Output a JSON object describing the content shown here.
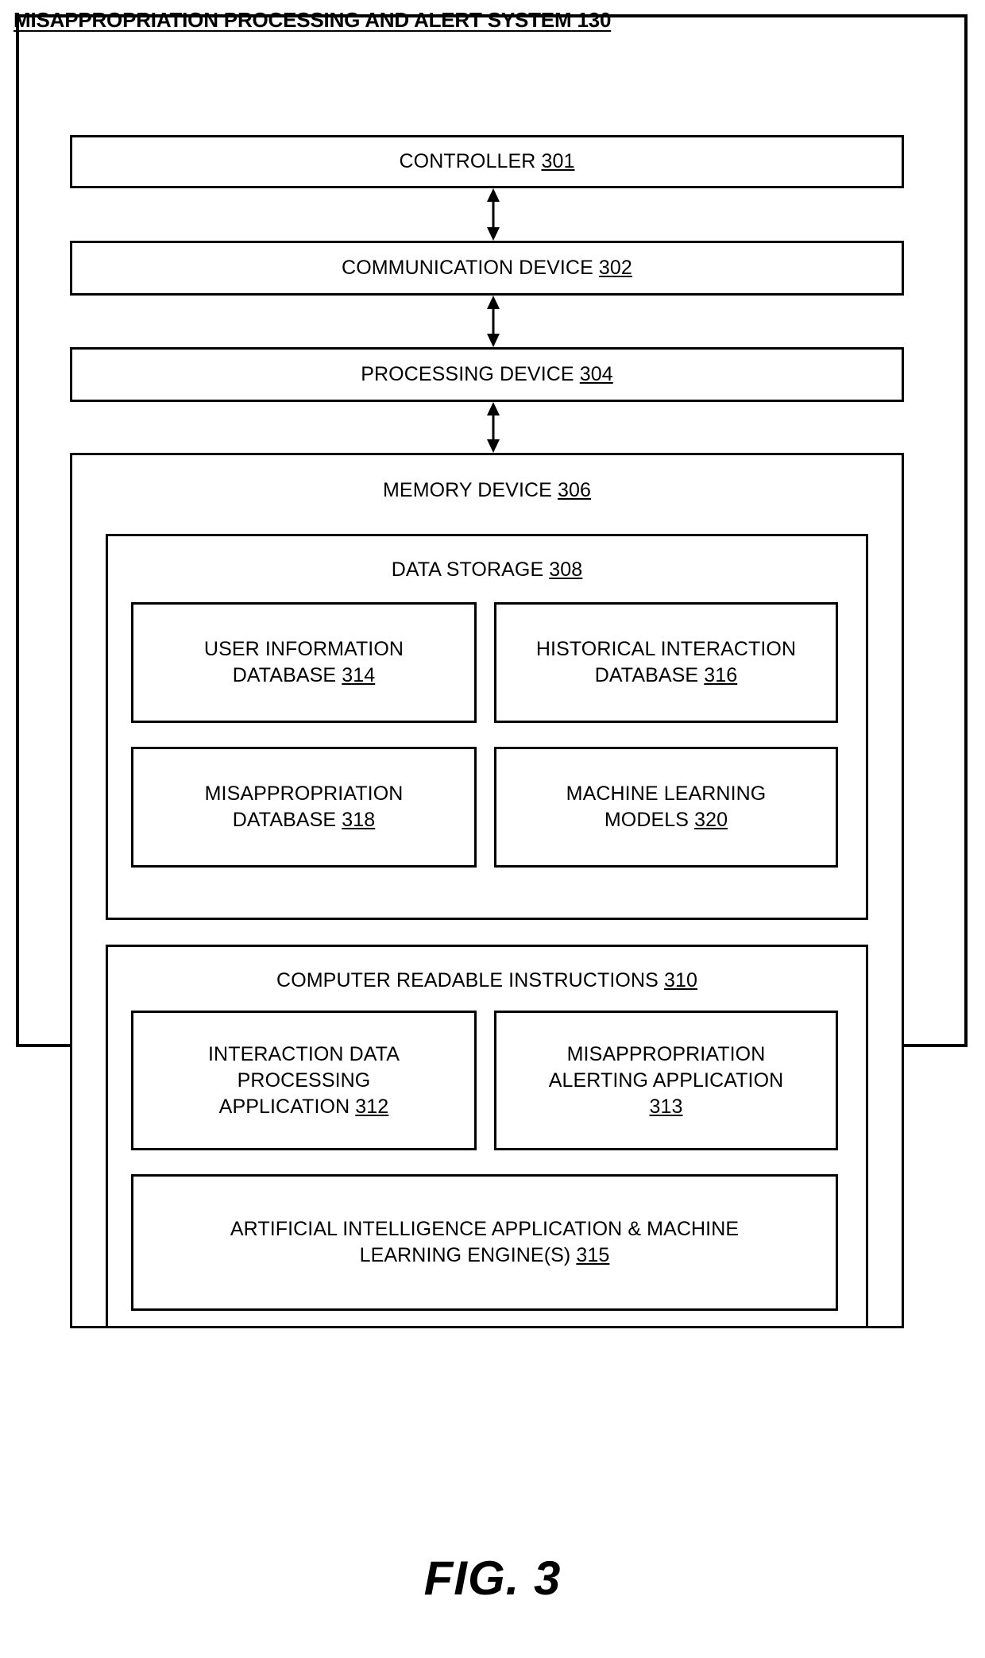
{
  "figure": {
    "caption": "FIG. 3"
  },
  "system": {
    "title_text": "MISAPPROPRIATION PROCESSING AND ALERT SYSTEM 130",
    "title_label": "MISAPPROPRIATION PROCESSING AND ALERT SYSTEM",
    "title_ref": "130"
  },
  "blocks": {
    "controller": {
      "label": "CONTROLLER",
      "ref": "301"
    },
    "communication_device": {
      "label": "COMMUNICATION DEVICE",
      "ref": "302"
    },
    "processing_device": {
      "label": "PROCESSING DEVICE",
      "ref": "304"
    },
    "memory_device": {
      "label": "MEMORY DEVICE",
      "ref": "306"
    },
    "data_storage": {
      "label": "DATA STORAGE",
      "ref": "308"
    },
    "computer_readable_instructions": {
      "label": "COMPUTER READABLE INSTRUCTIONS",
      "ref": "310"
    },
    "user_information_database": {
      "label": "USER INFORMATION\nDATABASE",
      "ref": "314"
    },
    "historical_interaction_database": {
      "label": "HISTORICAL INTERACTION\nDATABASE",
      "ref": "316"
    },
    "misappropriation_database": {
      "label": "MISAPPROPRIATION\nDATABASE",
      "ref": "318"
    },
    "machine_learning_models": {
      "label": "MACHINE LEARNING\nMODELS",
      "ref": "320"
    },
    "interaction_data_processing_application": {
      "label": "INTERACTION DATA\nPROCESSING\nAPPLICATION",
      "ref": "312"
    },
    "misappropriation_alerting_application": {
      "label": "MISAPPROPRIATION\nALERTING APPLICATION\n",
      "ref": "313"
    },
    "ai_application_ml_engines": {
      "label": "ARTIFICIAL INTELLIGENCE APPLICATION & MACHINE\nLEARNING ENGINE(S)",
      "ref": "315"
    }
  },
  "connectors": [
    {
      "name": "controller-to-communication",
      "type": "double-arrow"
    },
    {
      "name": "communication-to-processing",
      "type": "double-arrow"
    },
    {
      "name": "processing-to-memory",
      "type": "double-arrow"
    }
  ],
  "colors": {
    "stroke": "#000000",
    "background": "#ffffff"
  }
}
